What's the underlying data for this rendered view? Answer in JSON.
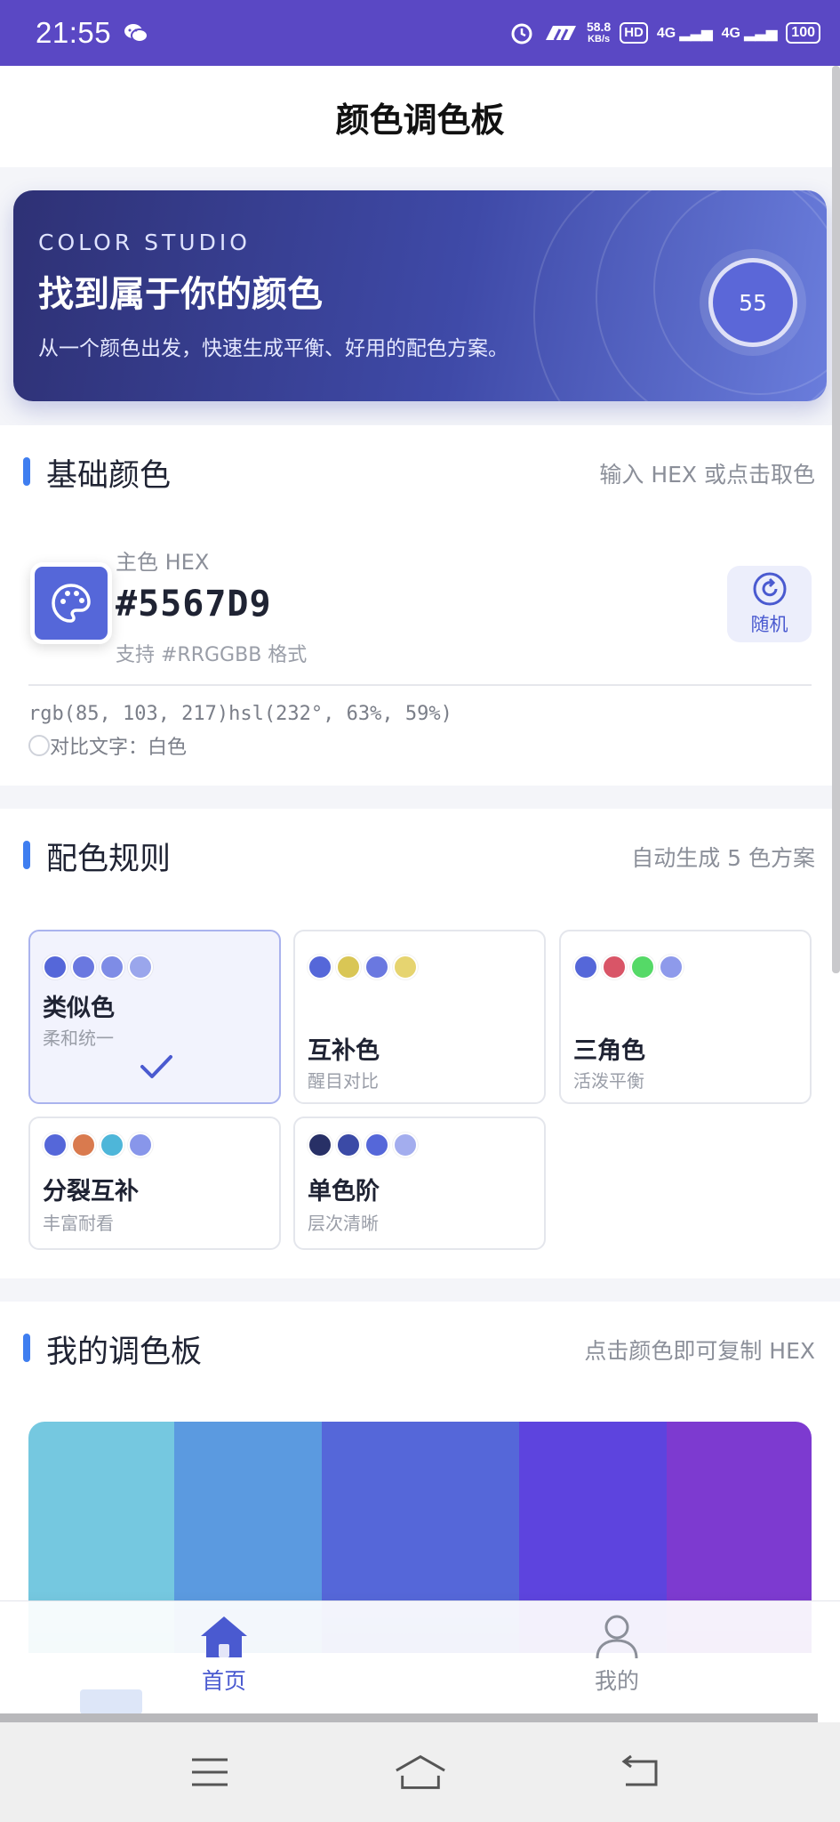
{
  "status_bar": {
    "time": "21:55",
    "speed_top": "58.8",
    "speed_unit": "KB/s",
    "hd": "HD",
    "sim1": "4G",
    "sim2": "4G",
    "battery": "100"
  },
  "header": {
    "title": "颜色调色板"
  },
  "hero": {
    "eyebrow": "COLOR STUDIO",
    "title": "找到属于你的颜色",
    "subtitle": "从一个颜色出发，快速生成平衡、好用的配色方案。",
    "badge": "55"
  },
  "base_color": {
    "title": "基础颜色",
    "hint": "输入 HEX 或点击取色",
    "hex_label": "主色 HEX",
    "hex_value": "#5567D9",
    "hex_hint": "支持 #RRGGBB 格式",
    "random_label": "随机",
    "rgb_hsl": "rgb(85, 103, 217)hsl(232°, 63%, 59%)",
    "contrast": "对比文字：白色",
    "color": "#5567D9"
  },
  "rules": {
    "title": "配色规则",
    "hint": "自动生成 5 色方案",
    "items": [
      {
        "name": "类似色",
        "desc": "柔和统一",
        "selected": true,
        "dots": [
          "#5567d9",
          "#6a78e0",
          "#7e8ce6",
          "#9aa6ec"
        ]
      },
      {
        "name": "互补色",
        "desc": "醒目对比",
        "selected": false,
        "dots": [
          "#5567d9",
          "#d9c655",
          "#6a78e0",
          "#e6d470"
        ]
      },
      {
        "name": "三角色",
        "desc": "活泼平衡",
        "selected": false,
        "dots": [
          "#5567d9",
          "#d95567",
          "#55d967",
          "#8e9aeb"
        ]
      },
      {
        "name": "分裂互补",
        "desc": "丰富耐看",
        "selected": false,
        "dots": [
          "#5567d9",
          "#d97a4e",
          "#4eb6d9",
          "#8896ea"
        ]
      },
      {
        "name": "单色阶",
        "desc": "层次清晰",
        "selected": false,
        "dots": [
          "#283066",
          "#3b4aa6",
          "#5567d9",
          "#a3adee"
        ]
      }
    ]
  },
  "my_palette": {
    "title": "我的调色板",
    "hint": "点击颜色即可复制 HEX",
    "swatches": [
      "#75c8e0",
      "#5b9ae0",
      "#5567d9",
      "#5d44de",
      "#7d3ad0"
    ]
  },
  "tabbar": {
    "home_label": "首页",
    "mine_label": "我的"
  }
}
